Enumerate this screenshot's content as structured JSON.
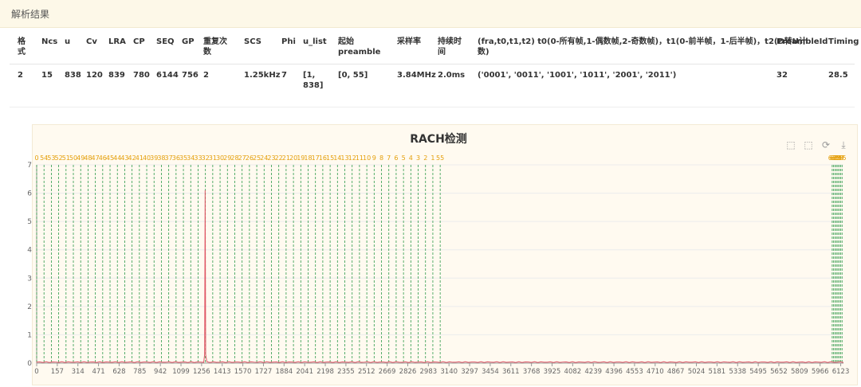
{
  "header": {
    "title": "解析结果"
  },
  "table": {
    "headers": [
      {
        "key": "fmt",
        "lines": [
          "格",
          "式"
        ]
      },
      {
        "key": "ncs",
        "lines": [
          "Ncs"
        ]
      },
      {
        "key": "u",
        "lines": [
          "u"
        ]
      },
      {
        "key": "cv",
        "lines": [
          "Cv"
        ]
      },
      {
        "key": "lra",
        "lines": [
          "LRA"
        ]
      },
      {
        "key": "cp",
        "lines": [
          "CP"
        ]
      },
      {
        "key": "seq",
        "lines": [
          "SEQ"
        ]
      },
      {
        "key": "gp",
        "lines": [
          "GP"
        ]
      },
      {
        "key": "rep",
        "lines": [
          "重复次",
          "数"
        ]
      },
      {
        "key": "scs",
        "lines": [
          "SCS"
        ]
      },
      {
        "key": "phi",
        "lines": [
          "Phi"
        ]
      },
      {
        "key": "ulist",
        "lines": [
          "u_list"
        ]
      },
      {
        "key": "start",
        "lines": [
          "起始",
          "preamble"
        ]
      },
      {
        "key": "rate",
        "lines": [
          "采样率"
        ]
      },
      {
        "key": "dur",
        "lines": [
          "持续时",
          "间"
        ]
      },
      {
        "key": "frame",
        "lines": [
          "(fra,t0,t1,t2) t0(0-所有帧,1-偶数帧,2-奇数帧)，t1(0-前半帧，1-后半帧)，t2(D转U计",
          "数)"
        ]
      },
      {
        "key": "pid",
        "lines": [
          "PreambleId"
        ]
      },
      {
        "key": "timing",
        "lines": [
          "Timing"
        ]
      }
    ],
    "row": {
      "fmt": [
        "2"
      ],
      "ncs": [
        "15"
      ],
      "u": [
        "838"
      ],
      "cv": [
        "120"
      ],
      "lra": [
        "839"
      ],
      "cp": [
        "780"
      ],
      "seq": [
        "6144"
      ],
      "gp": [
        "756"
      ],
      "rep": [
        "2"
      ],
      "scs": [
        "1.25kHz"
      ],
      "phi": [
        "7"
      ],
      "ulist": [
        "[1,",
        "838]"
      ],
      "start": [
        "[0, 55]"
      ],
      "rate": [
        "3.84MHz"
      ],
      "dur": [
        "2.0ms"
      ],
      "frame": [
        "('0001', '0011', '1001', '1011', '2001', '2011')"
      ],
      "pid": [
        "32"
      ],
      "timing": [
        "28.5"
      ]
    }
  },
  "chart_data": {
    "type": "line",
    "title": "RACH检测",
    "xlim": [
      0,
      6144
    ],
    "ylim": [
      0,
      7
    ],
    "y_ticks": [
      0,
      1,
      2,
      3,
      4,
      5,
      6,
      7
    ],
    "x_ticks": [
      0,
      157,
      314,
      471,
      628,
      785,
      942,
      1099,
      1256,
      1413,
      1570,
      1727,
      1884,
      2041,
      2198,
      2355,
      2512,
      2669,
      2826,
      2983,
      3140,
      3297,
      3454,
      3611,
      3768,
      3925,
      4082,
      4239,
      4396,
      4553,
      4710,
      4867,
      5024,
      5181,
      5338,
      5495,
      5652,
      5809,
      5966,
      6123
    ],
    "marker_lines": {
      "spacing": 55.87,
      "labels_left": [
        "0",
        "54",
        "53",
        "52",
        "51",
        "50",
        "49",
        "48",
        "47",
        "46",
        "45",
        "44",
        "43",
        "42",
        "41",
        "40",
        "39",
        "38",
        "37",
        "36",
        "35",
        "34",
        "33",
        "32",
        "31",
        "30",
        "29",
        "28",
        "27",
        "26",
        "25",
        "24",
        "23",
        "22",
        "21",
        "20",
        "19",
        "18",
        "17",
        "16",
        "15",
        "14",
        "13",
        "12",
        "11",
        "10",
        "9",
        "8",
        "7",
        "6",
        "5",
        "4",
        "3",
        "2",
        "1",
        "55"
      ],
      "labels_right": [
        "63",
        "62",
        "61",
        "60",
        "59",
        "58",
        "57",
        "56"
      ],
      "color": "#2e9a4a",
      "label_color": "#e5a00d"
    },
    "series": [
      {
        "color": "#e05565",
        "peak": {
          "x": 1283,
          "y": 6.1
        },
        "baseline": 0.02
      }
    ],
    "grid": true
  },
  "toolbox": [
    "zoom-icon",
    "zoom-reset-icon",
    "restore-icon",
    "download-icon"
  ]
}
